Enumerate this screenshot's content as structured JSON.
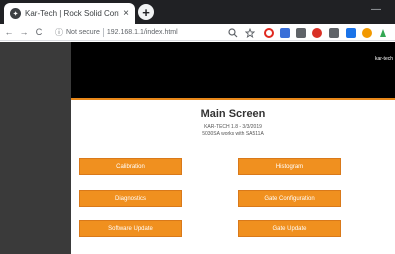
{
  "browser": {
    "tab_title": "Kar-Tech | Rock Solid Controls",
    "tab_close": "×",
    "new_tab": "+",
    "minimize": "—",
    "back": "←",
    "forward": "→",
    "reload": "C",
    "info_icon": "ⓘ",
    "security_label": "Not secure",
    "url": "192.168.1.1/index.html"
  },
  "page": {
    "title": "Main Screen",
    "subtitle_line1": "KAR-TECH 1.8 - 3/3/2019",
    "subtitle_line2": "5030SA works with SA511A",
    "banner_mark": "kar-tech"
  },
  "buttons": {
    "calibration": "Calibration",
    "histogram": "Histogram",
    "diagnostics": "Diagnostics",
    "gate_configuration": "Gate Configuration",
    "software_update": "Software Update",
    "gate_update": "Gate Update"
  },
  "colors": {
    "accent": "#f0901f",
    "sidebar": "#3a3a3a",
    "banner": "#000000"
  }
}
